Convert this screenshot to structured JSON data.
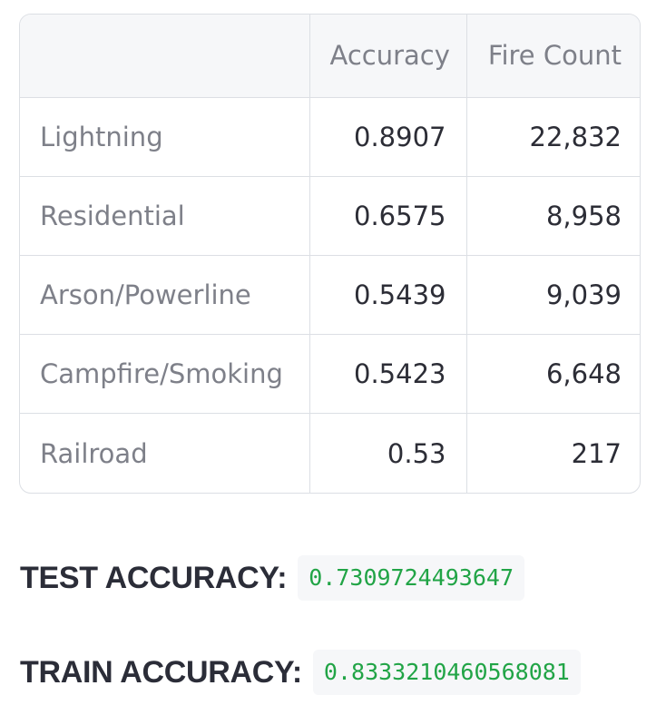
{
  "table": {
    "columns": [
      "",
      "Accuracy",
      "Fire Count"
    ],
    "rows": [
      {
        "label": "Lightning",
        "accuracy": "0.8907",
        "fire_count": "22,832"
      },
      {
        "label": "Residential",
        "accuracy": "0.6575",
        "fire_count": "8,958"
      },
      {
        "label": "Arson/Powerline",
        "accuracy": "0.5439",
        "fire_count": "9,039"
      },
      {
        "label": "Campfire/Smoking",
        "accuracy": "0.5423",
        "fire_count": "6,648"
      },
      {
        "label": "Railroad",
        "accuracy": "0.53",
        "fire_count": "217"
      }
    ]
  },
  "metrics": {
    "test": {
      "label": "TEST ACCURACY:",
      "value": "0.7309724493647"
    },
    "train": {
      "label": "TRAIN ACCURACY:",
      "value": "0.8333210460568081"
    }
  },
  "colors": {
    "header_bg": "#f6f7f9",
    "border": "#dcdfe4",
    "label_text": "#7e8089",
    "number_text": "#2c2d36",
    "code_green": "#21a446"
  }
}
